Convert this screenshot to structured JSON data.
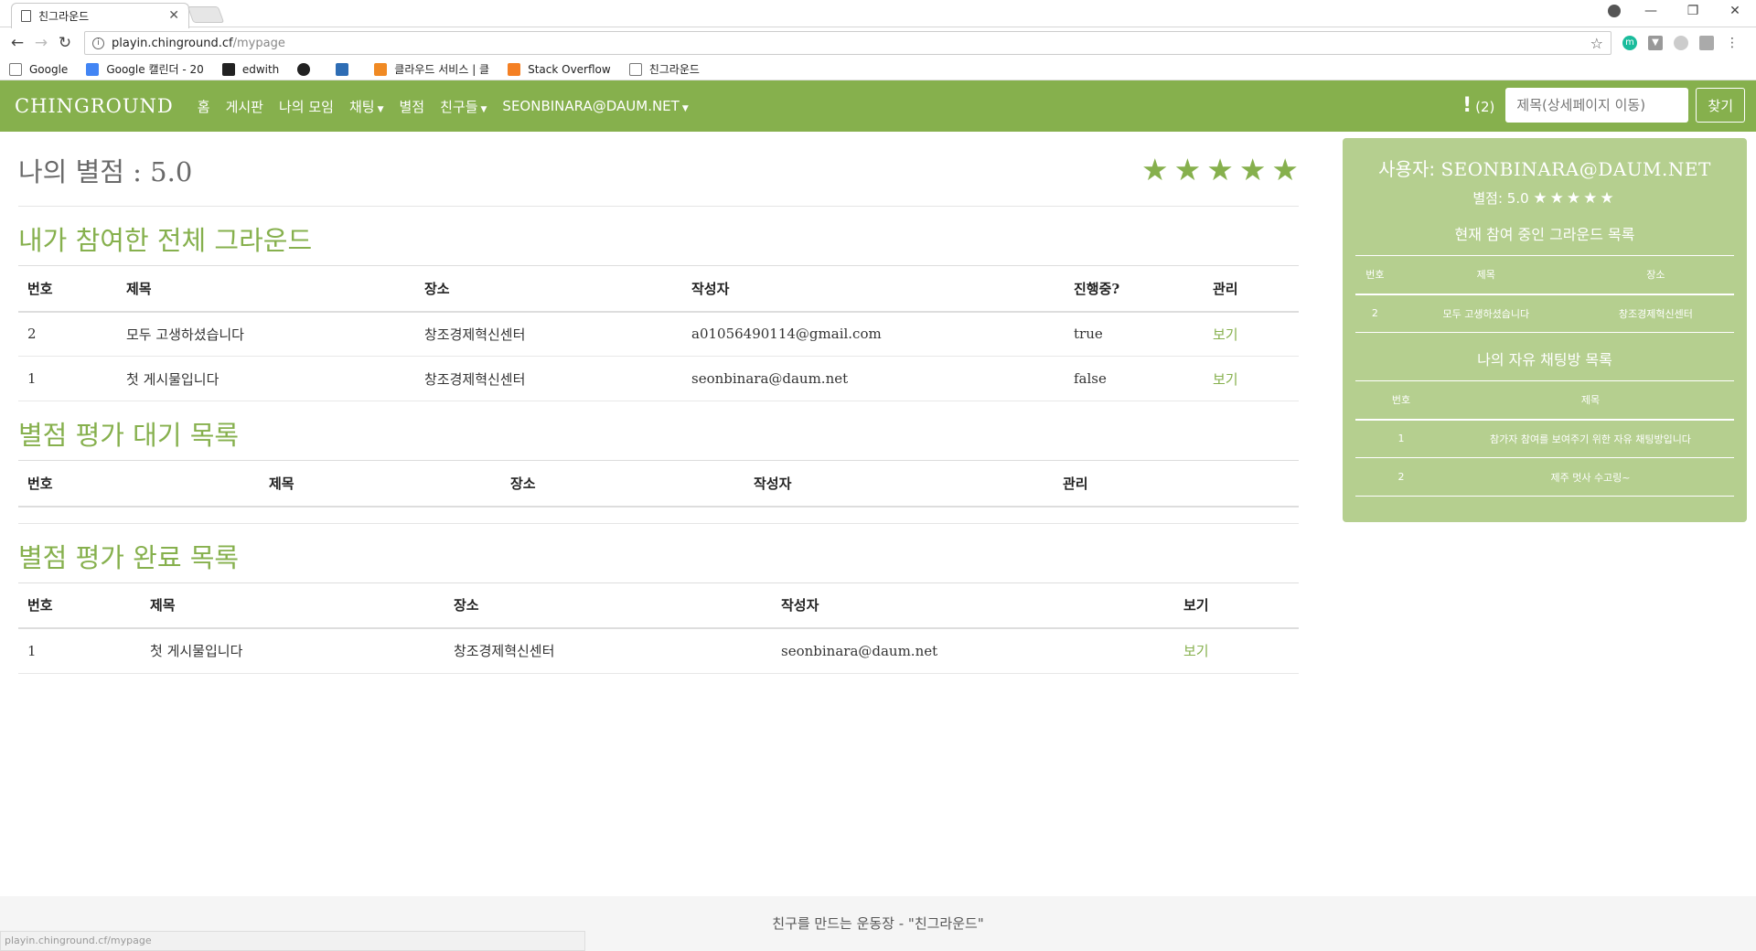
{
  "browser": {
    "tab_title": "친그라운드",
    "url_host": "playin.chinground.cf",
    "url_path": "/mypage",
    "bookmarks": [
      "Google",
      "Google 캘린더 - 20",
      "edwith",
      "",
      "",
      "",
      "클라우드 서비스 | 클",
      "Stack Overflow",
      "친그라운드"
    ],
    "status_url": "playin.chinground.cf/mypage"
  },
  "nav": {
    "brand": "CHINGROUND",
    "items": [
      "홈",
      "게시판",
      "나의 모임",
      "채팅",
      "별점",
      "친구들",
      "SEONBINARA@DAUM.NET"
    ],
    "alert_count": "(2)",
    "search_placeholder": "제목(상세페이지 이동)",
    "search_button": "찾기"
  },
  "rating": {
    "title": "나의 별점 : 5.0",
    "stars": 5
  },
  "all_grounds": {
    "title": "내가 참여한 전체 그라운드",
    "headers": [
      "번호",
      "제목",
      "장소",
      "작성자",
      "진행중?",
      "관리"
    ],
    "rows": [
      [
        "2",
        "모두 고생하셨습니다",
        "창조경제혁신센터",
        "a01056490114@gmail.com",
        "true",
        "보기"
      ],
      [
        "1",
        "첫 게시물입니다",
        "창조경제혁신센터",
        "seonbinara@daum.net",
        "false",
        "보기"
      ]
    ]
  },
  "pending": {
    "title": "별점 평가 대기 목록",
    "headers": [
      "번호",
      "제목",
      "장소",
      "작성자",
      "관리"
    ]
  },
  "done": {
    "title": "별점 평가 완료 목록",
    "headers": [
      "번호",
      "제목",
      "장소",
      "작성자",
      "보기"
    ],
    "rows": [
      [
        "1",
        "첫 게시물입니다",
        "창조경제혁신센터",
        "seonbinara@daum.net",
        "보기"
      ]
    ]
  },
  "sidebar": {
    "user_label": "사용자:",
    "user_email": "SEONBINARA@DAUM.NET",
    "rating_label": "별점: 5.0",
    "current_title": "현재 참여 중인 그라운드 목록",
    "current_headers": [
      "번호",
      "제목",
      "장소"
    ],
    "current_rows": [
      [
        "2",
        "모두 고생하셨습니다",
        "창조경제혁신센터"
      ]
    ],
    "chat_title": "나의 자유 채팅방 목록",
    "chat_headers": [
      "번호",
      "제목"
    ],
    "chat_rows": [
      [
        "1",
        "참가자 참여를 보여주기 위한 자유 채팅방입니다"
      ],
      [
        "2",
        "제주 멋사 수고링~"
      ]
    ]
  },
  "footer": "친구를 만드는 운동장 - \"친그라운드\"",
  "colors": {
    "accent": "#86b04d",
    "sidebar": "#b5cf8f"
  }
}
